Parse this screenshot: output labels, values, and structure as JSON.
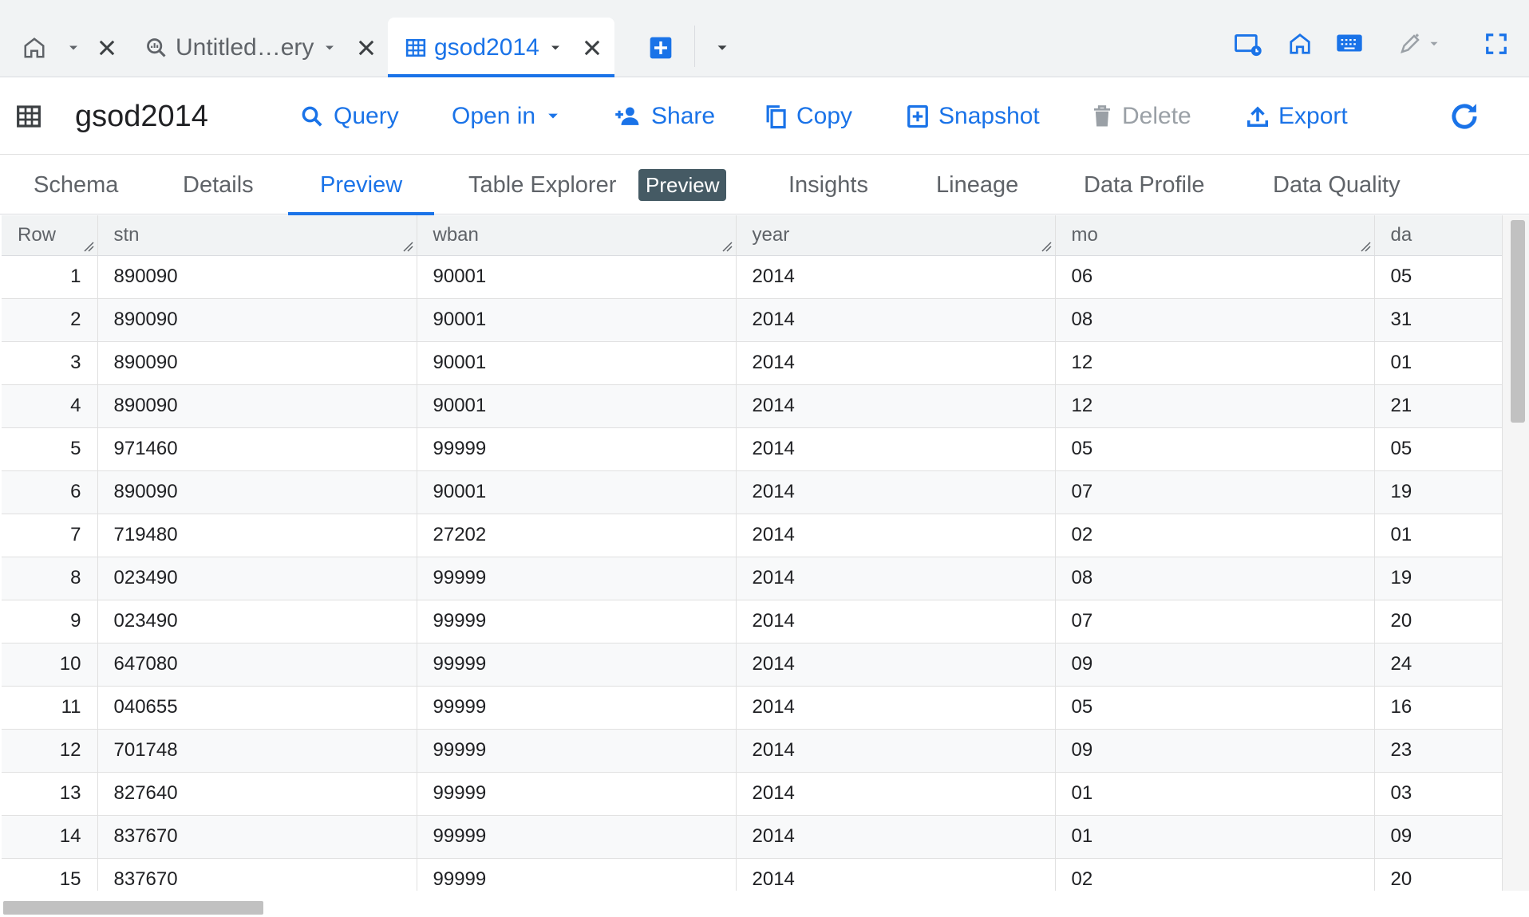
{
  "tabs": [
    {
      "label": "",
      "icon": "home-icon"
    },
    {
      "label": "Untitled…ery",
      "icon": "query-icon"
    },
    {
      "label": "gsod2014",
      "icon": "table-icon",
      "active": true
    }
  ],
  "header": {
    "title": "gsod2014",
    "actions": {
      "query": "Query",
      "open_in": "Open in",
      "share": "Share",
      "copy": "Copy",
      "snapshot": "Snapshot",
      "delete": "Delete",
      "export": "Export"
    }
  },
  "subtabs": {
    "schema": "Schema",
    "details": "Details",
    "preview": "Preview",
    "table_explorer": "Table Explorer",
    "table_explorer_badge": "Preview",
    "insights": "Insights",
    "lineage": "Lineage",
    "data_profile": "Data Profile",
    "data_quality": "Data Quality"
  },
  "colors": {
    "accent": "#1a73e8",
    "badge": "#455a64",
    "muted": "#5f6368"
  },
  "table": {
    "columns": [
      "Row",
      "stn",
      "wban",
      "year",
      "mo",
      "da"
    ],
    "rows": [
      [
        "1",
        "890090",
        "90001",
        "2014",
        "06",
        "05"
      ],
      [
        "2",
        "890090",
        "90001",
        "2014",
        "08",
        "31"
      ],
      [
        "3",
        "890090",
        "90001",
        "2014",
        "12",
        "01"
      ],
      [
        "4",
        "890090",
        "90001",
        "2014",
        "12",
        "21"
      ],
      [
        "5",
        "971460",
        "99999",
        "2014",
        "05",
        "05"
      ],
      [
        "6",
        "890090",
        "90001",
        "2014",
        "07",
        "19"
      ],
      [
        "7",
        "719480",
        "27202",
        "2014",
        "02",
        "01"
      ],
      [
        "8",
        "023490",
        "99999",
        "2014",
        "08",
        "19"
      ],
      [
        "9",
        "023490",
        "99999",
        "2014",
        "07",
        "20"
      ],
      [
        "10",
        "647080",
        "99999",
        "2014",
        "09",
        "24"
      ],
      [
        "11",
        "040655",
        "99999",
        "2014",
        "05",
        "16"
      ],
      [
        "12",
        "701748",
        "99999",
        "2014",
        "09",
        "23"
      ],
      [
        "13",
        "827640",
        "99999",
        "2014",
        "01",
        "03"
      ],
      [
        "14",
        "837670",
        "99999",
        "2014",
        "01",
        "09"
      ],
      [
        "15",
        "837670",
        "99999",
        "2014",
        "02",
        "20"
      ]
    ]
  }
}
